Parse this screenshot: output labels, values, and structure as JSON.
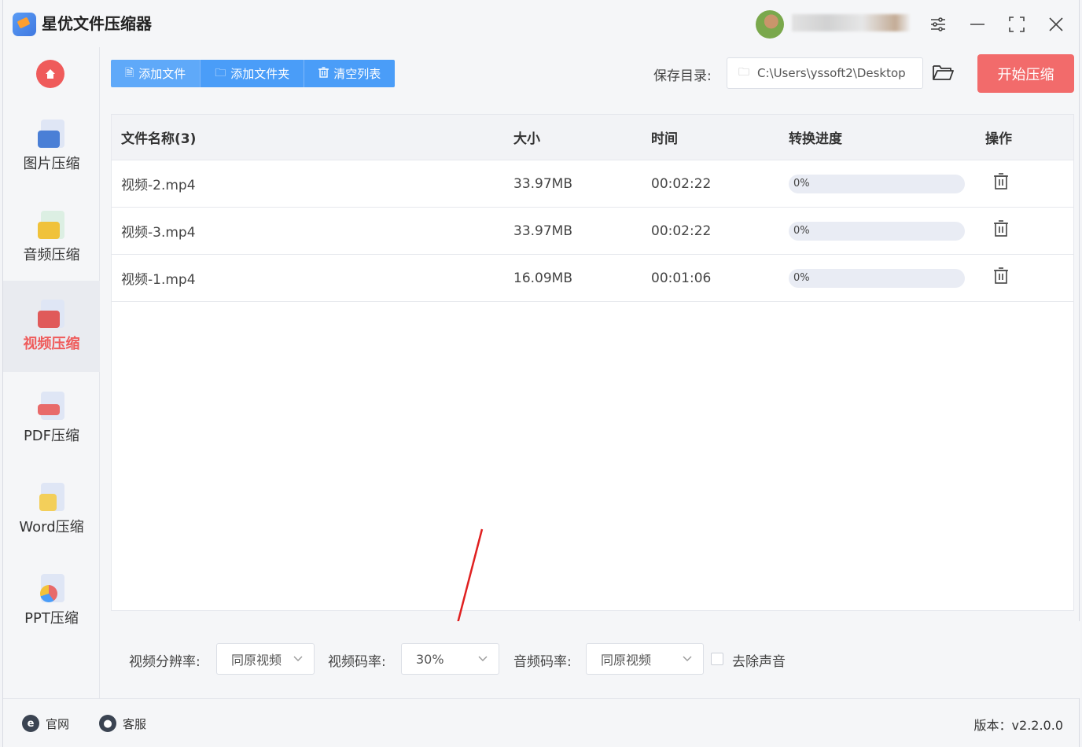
{
  "window": {
    "title": "星优文件压缩器",
    "controls": [
      "settings-icon",
      "minimize-icon",
      "maximize-icon",
      "close-icon"
    ]
  },
  "sidebar": {
    "items": [
      {
        "label": "图片压缩",
        "icon": "image-file-icon",
        "active": false
      },
      {
        "label": "音频压缩",
        "icon": "audio-file-icon",
        "active": false
      },
      {
        "label": "视频压缩",
        "icon": "video-file-icon",
        "active": true
      },
      {
        "label": "PDF压缩",
        "icon": "pdf-file-icon",
        "active": false
      },
      {
        "label": "Word压缩",
        "icon": "word-file-icon",
        "active": false
      },
      {
        "label": "PPT压缩",
        "icon": "ppt-file-icon",
        "active": false
      }
    ]
  },
  "toolbar": {
    "add_file": "添加文件",
    "add_folder": "添加文件夹",
    "clear_list": "清空列表",
    "save_label": "保存目录:",
    "save_path": "C:\\Users\\yssoft2\\Desktop",
    "start": "开始压缩"
  },
  "table": {
    "headers": [
      "文件名称(3)",
      "大小",
      "时间",
      "转换进度",
      "操作"
    ],
    "rows": [
      {
        "name": "视频-2.mp4",
        "size": "33.97MB",
        "time": "00:02:22",
        "progress": "0%",
        "progress_value": 0
      },
      {
        "name": "视频-3.mp4",
        "size": "33.97MB",
        "time": "00:02:22",
        "progress": "0%",
        "progress_value": 0
      },
      {
        "name": "视频-1.mp4",
        "size": "16.09MB",
        "time": "00:01:06",
        "progress": "0%",
        "progress_value": 0
      }
    ]
  },
  "settings": {
    "resolution_label": "视频分辨率:",
    "resolution_value": "同原视频",
    "bitrate_label": "视频码率:",
    "bitrate_value": "30%",
    "audio_label": "音频码率:",
    "audio_value": "同原视频",
    "mute_label": "去除声音"
  },
  "footer": {
    "website": "官网",
    "support": "客服",
    "version": "版本：v2.2.0.0"
  },
  "colors": {
    "accent_blue": "#4a9df8",
    "accent_red": "#f26b6b",
    "active_nav": "#ef5b5b"
  }
}
